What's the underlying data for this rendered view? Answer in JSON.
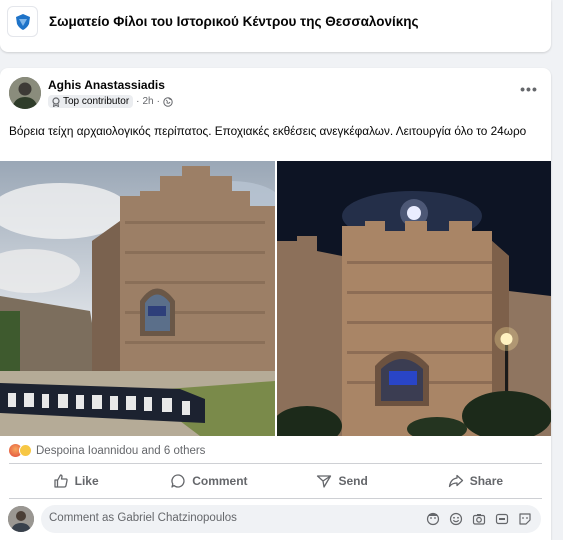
{
  "group": {
    "name": "Σωματείο Φίλοι του Ιστορικού Κέντρου της Θεσσαλονίκης",
    "logo_color": "#1e73c8"
  },
  "post": {
    "author": "Aghis Anastassiadis",
    "badge": "Top contributor",
    "separator": "·",
    "time": "2h",
    "audience_icon": "globe-icon",
    "more_label": "•••",
    "text": "Βόρεια τείχη αρχαιολογικός περίπατος. Εποχιακές εκθέσεις ανεγκέφαλων. Λειτουργία όλο το 24ωρο",
    "reactions_text": "Despoina Ioannidou and 6 others",
    "reaction_icons": [
      "angry-face-icon",
      "sad-face-icon"
    ]
  },
  "actions": {
    "like": "Like",
    "comment": "Comment",
    "send": "Send",
    "share": "Share"
  },
  "comment_box": {
    "placeholder": "Comment as Gabriel Chatzinopoulos",
    "icons": [
      "avatar-sticker-icon",
      "emoji-icon",
      "camera-icon",
      "gif-icon",
      "sticker-icon"
    ]
  },
  "colors": {
    "accent": "#1877f2",
    "secondary_text": "#65676b",
    "divider": "#ced0d4"
  }
}
